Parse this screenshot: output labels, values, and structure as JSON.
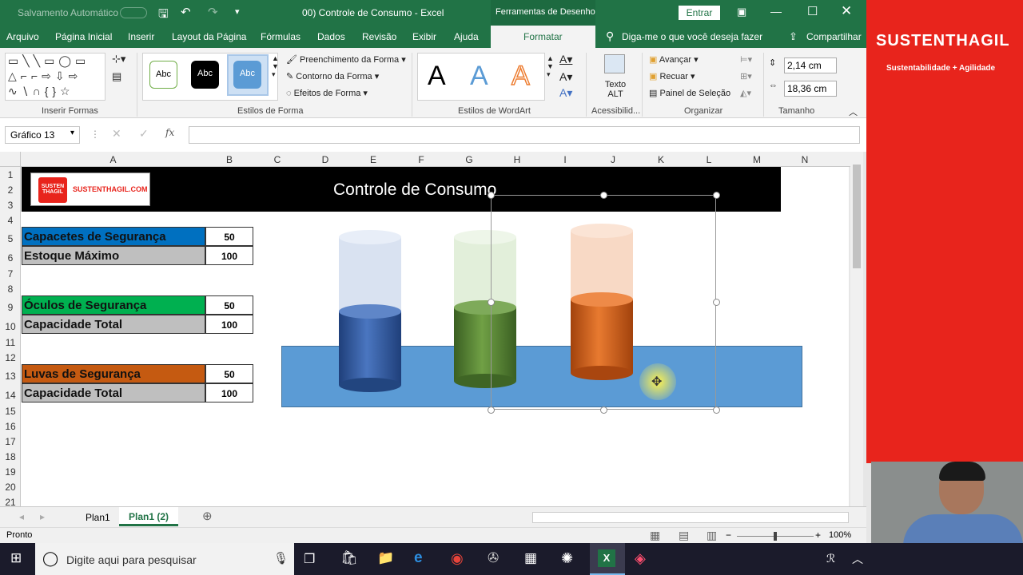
{
  "titlebar": {
    "autosave_label": "Salvamento Automático",
    "doc_title": "00) Controle de Consumo  -  Excel",
    "context_tab": "Ferramentas de Desenho",
    "signin": "Entrar"
  },
  "tabs": [
    "Arquivo",
    "Página Inicial",
    "Inserir",
    "Layout da Página",
    "Fórmulas",
    "Dados",
    "Revisão",
    "Exibir",
    "Ajuda",
    "Formatar"
  ],
  "tell_me": "Diga-me o que você deseja fazer",
  "share": "Compartilhar",
  "ribbon": {
    "groups": [
      "Inserir Formas",
      "Estilos de Forma",
      "Estilos de WordArt",
      "Acessibilid...",
      "Organizar",
      "Tamanho"
    ],
    "shape_style_sample": "Abc",
    "fill": "Preenchimento da Forma",
    "outline": "Contorno da Forma",
    "effects": "Efeitos de Forma",
    "wordart_sample": "A",
    "alt_text": "Texto ALT",
    "bring_forward": "Avançar",
    "send_backward": "Recuar",
    "selection_pane": "Painel de Seleção",
    "height": "2,14 cm",
    "width": "18,36 cm"
  },
  "formula_bar": {
    "name_box": "Gráfico 13",
    "fx": "fx"
  },
  "columns": [
    "A",
    "B",
    "C",
    "D",
    "E",
    "F",
    "G",
    "H",
    "I",
    "J",
    "K",
    "L",
    "M",
    "N"
  ],
  "rows": [
    "1",
    "2",
    "3",
    "4",
    "5",
    "6",
    "7",
    "8",
    "9",
    "10",
    "11",
    "12",
    "13",
    "14",
    "15",
    "16",
    "17",
    "18",
    "19",
    "20",
    "21"
  ],
  "sheet": {
    "logo_text": "SUSTENTHAGIL.COM",
    "logo_badge": "SUSTEN THAGIL",
    "banner_title": "Controle de Consumo",
    "items": [
      {
        "label": "Capacetes de Segurança",
        "value": "50",
        "color": "#0070c0"
      },
      {
        "label": "Estoque Máximo",
        "value": "100",
        "color": "#bfbfbf"
      },
      {
        "label": "Óculos de Segurança",
        "value": "50",
        "color": "#00b050"
      },
      {
        "label": "Capacidade Total",
        "value": "100",
        "color": "#bfbfbf"
      },
      {
        "label": "Luvas de Segurança",
        "value": "50",
        "color": "#c55a11"
      },
      {
        "label": "Capacidade Total",
        "value": "100",
        "color": "#bfbfbf"
      }
    ]
  },
  "sheet_tabs": [
    "Plan1",
    "Plan1 (2)"
  ],
  "status": {
    "ready": "Pronto",
    "zoom": "100%"
  },
  "taskbar": {
    "search": "Digite aqui para pesquisar"
  },
  "brand": {
    "name": "SUSTENTHAGIL",
    "tagline": "Sustentabilidade + Agilidade"
  }
}
